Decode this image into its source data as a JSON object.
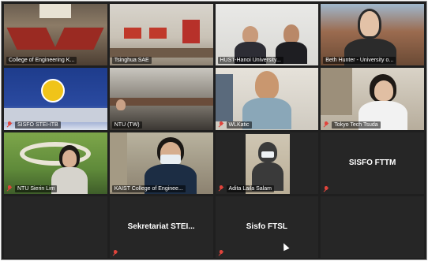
{
  "participants": [
    {
      "name": "College of Engineering K...",
      "muted": false,
      "video": true
    },
    {
      "name": "Tsinghua SAE",
      "muted": false,
      "video": true
    },
    {
      "name": "HUST-Hanoi University...",
      "muted": false,
      "video": true
    },
    {
      "name": "Beth Hunter - University o...",
      "muted": false,
      "video": true
    },
    {
      "name": "SISFO STEI-ITB",
      "muted": true,
      "video": true
    },
    {
      "name": "NTU (TW)",
      "muted": false,
      "video": true
    },
    {
      "name": "WLKatic",
      "muted": true,
      "video": true
    },
    {
      "name": "Tokyo Tech Tsuda",
      "muted": true,
      "video": true
    },
    {
      "name": "NTU Sierin Lim",
      "muted": true,
      "video": true
    },
    {
      "name": "KAIST College of Enginee...",
      "muted": false,
      "video": true,
      "speaking": true
    },
    {
      "name": "Adita Laila Salam",
      "muted": true,
      "video": true
    },
    {
      "name": "SISFO FTTM",
      "muted": true,
      "video": false
    },
    {
      "name": "",
      "muted": false,
      "video": false
    },
    {
      "name": "Sekretariat STEI...",
      "muted": true,
      "video": false
    },
    {
      "name": "Sisfo FTSL",
      "muted": true,
      "video": false
    },
    {
      "name": "",
      "muted": false,
      "video": false
    }
  ],
  "colors": {
    "speaking_outline": "#c8d64a",
    "muted_icon": "#e0443c",
    "tile_bg": "#262626"
  }
}
